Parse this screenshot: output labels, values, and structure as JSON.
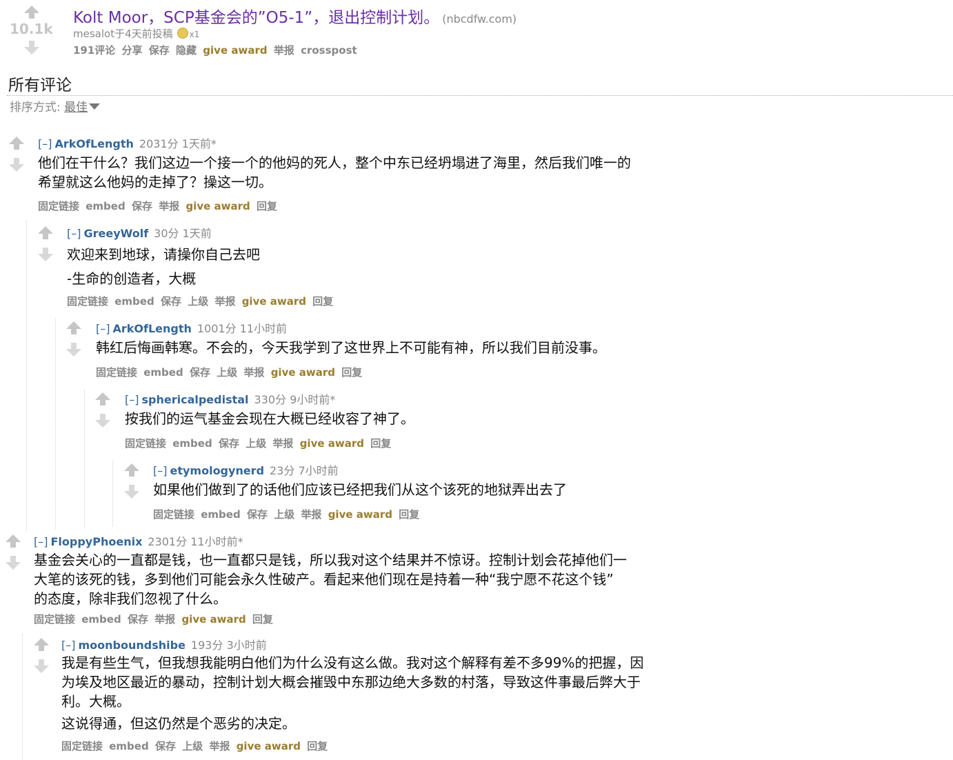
{
  "post": {
    "score": "10.1k",
    "title": "Kolt Moor，SCP基金会的”O5-1”，退出控制计划。",
    "domain": "(nbcdfw.com)",
    "tagline": "mesalot于4天前投稿",
    "gold_count": "x1",
    "buttons": {
      "comments": "191评论",
      "share": "分享",
      "save": "保存",
      "hide": "隐藏",
      "give_award": "give award",
      "report": "举报",
      "crosspost": "crosspost"
    }
  },
  "comments_section": {
    "title": "所有评论",
    "sort_label": "排序方式:",
    "sort_value": "最佳"
  },
  "comments": [
    {
      "expand": "[–]",
      "author": "ArkOfLength",
      "score": "2031分",
      "time": "1天前*",
      "body": [
        "他们在干什么？我们这边一个接一个的他妈的死人，整个中东已经坍塌进了海里，然后我们唯一的",
        "希望就这么他妈的走掉了？操这一切。"
      ],
      "buttons": {
        "permalink": "固定链接",
        "embed": "embed",
        "save": "保存",
        "report": "举报",
        "give_award": "give award",
        "reply": "回复"
      }
    },
    {
      "expand": "[–]",
      "author": "GreeyWolf",
      "score": "30分",
      "time": "1天前",
      "body": [
        "欢迎来到地球，请操你自己去吧",
        "-生命的创造者，大概"
      ],
      "buttons": {
        "permalink": "固定链接",
        "embed": "embed",
        "save": "保存",
        "parent": "上级",
        "report": "举报",
        "give_award": "give award",
        "reply": "回复"
      }
    },
    {
      "expand": "[–]",
      "author": "ArkOfLength",
      "score": "1001分",
      "time": "11小时前",
      "body": [
        "韩红后悔画韩寒。不会的，今天我学到了这世界上不可能有神，所以我们目前没事。"
      ],
      "buttons": {
        "permalink": "固定链接",
        "embed": "embed",
        "save": "保存",
        "parent": "上级",
        "report": "举报",
        "give_award": "give award",
        "reply": "回复"
      }
    },
    {
      "expand": "[–]",
      "author": "sphericalpedistal",
      "score": "330分",
      "time": "9小时前*",
      "body": [
        "按我们的运气基金会现在大概已经收容了神了。"
      ],
      "buttons": {
        "permalink": "固定链接",
        "embed": "embed",
        "save": "保存",
        "parent": "上级",
        "report": "举报",
        "give_award": "give award",
        "reply": "回复"
      }
    },
    {
      "expand": "[–]",
      "author": "etymologynerd",
      "score": "23分",
      "time": "7小时前",
      "body": [
        "如果他们做到了的话他们应该已经把我们从这个该死的地狱弄出去了"
      ],
      "buttons": {
        "permalink": "固定链接",
        "embed": "embed",
        "save": "保存",
        "parent": "上级",
        "report": "举报",
        "give_award": "give award",
        "reply": "回复"
      }
    },
    {
      "expand": "[–]",
      "author": "FloppyPhoenix",
      "score": "2301分",
      "time": "11小时前*",
      "body": [
        "基金会关心的一直都是钱，也一直都只是钱，所以我对这个结果并不惊讶。控制计划会花掉他们一",
        "大笔的该死的钱，多到他们可能会永久性破产。看起来他们现在是持着一种“我宁愿不花这个钱”",
        "的态度，除非我们忽视了什么。"
      ],
      "buttons": {
        "permalink": "固定链接",
        "embed": "embed",
        "save": "保存",
        "report": "举报",
        "give_award": "give award",
        "reply": "回复"
      }
    },
    {
      "expand": "[–]",
      "author": "moonboundshibe",
      "score": "193分",
      "time": "3小时前",
      "body": [
        "我是有些生气，但我想我能明白他们为什么没有这么做。我对这个解释有差不多99%的把握，因",
        "为埃及地区最近的暴动，控制计划大概会摧毁中东那边绝大多数的村落，导致这件事最后弊大于",
        "利。大概。",
        "这说得通，但这仍然是个恶劣的决定。"
      ],
      "buttons": {
        "permalink": "固定链接",
        "embed": "embed",
        "save": "保存",
        "parent": "上级",
        "report": "举报",
        "give_award": "give award",
        "reply": "回复"
      }
    }
  ]
}
